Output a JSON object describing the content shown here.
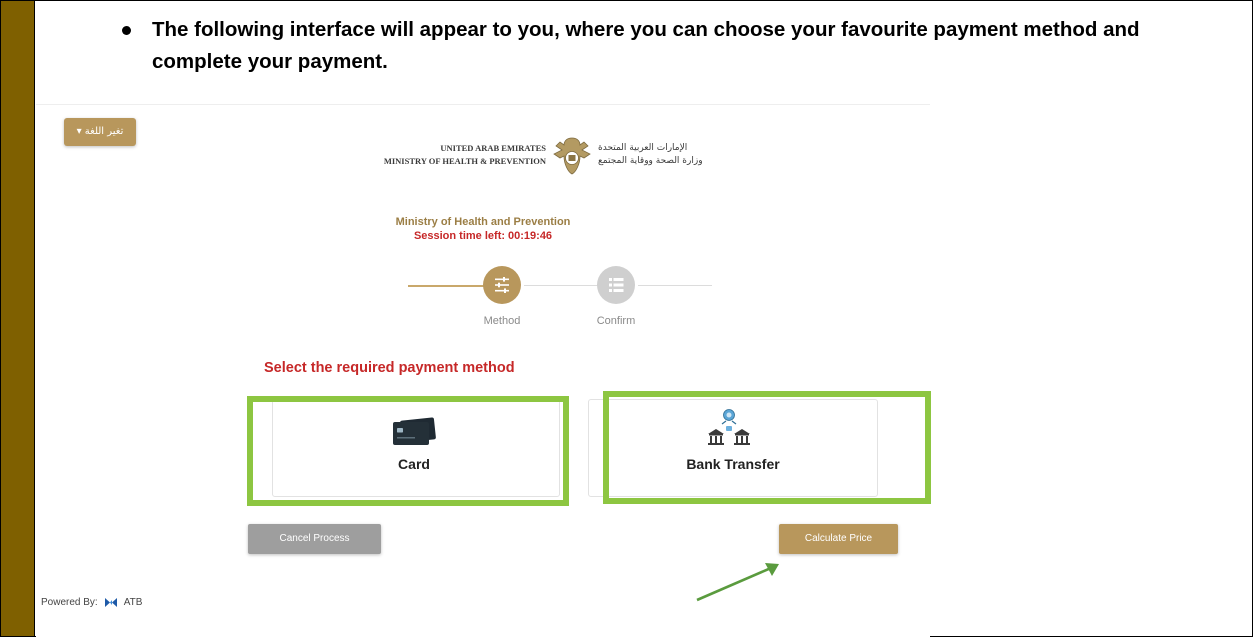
{
  "instruction": {
    "text": "The following interface will appear to you, where you can choose your favourite payment method and complete your payment."
  },
  "header": {
    "language_button": "▾ تغير اللغة",
    "en_line1": "UNITED ARAB EMIRATES",
    "en_line2": "MINISTRY OF HEALTH & PREVENTION",
    "ar_line1": "الإمارات العربية المتحدة",
    "ar_line2": "وزارة الصحة ووقاية المجتمع",
    "emblem_icon": "uae-emblem-icon"
  },
  "session": {
    "ministry": "Ministry of Health and Prevention",
    "label": "Session time left:",
    "time": "00:19:46"
  },
  "stepper": {
    "steps": [
      {
        "label": "Method",
        "icon": "sliders-icon",
        "active": true
      },
      {
        "label": "Confirm",
        "icon": "list-icon",
        "active": false
      }
    ]
  },
  "payment": {
    "title": "Select the required payment method",
    "options": [
      {
        "label": "Card",
        "icon": "credit-card-icon",
        "highlighted": true
      },
      {
        "label": "Bank Transfer",
        "icon": "bank-transfer-icon",
        "highlighted": true
      }
    ]
  },
  "actions": {
    "cancel": "Cancel Process",
    "calculate": "Calculate Price"
  },
  "footer": {
    "powered_label": "Powered By:",
    "powered_brand": "ATB"
  },
  "colors": {
    "gold": "#b8975c",
    "highlight": "#8dc641",
    "alert_red": "#c62828",
    "sidebar": "#7f6000"
  }
}
